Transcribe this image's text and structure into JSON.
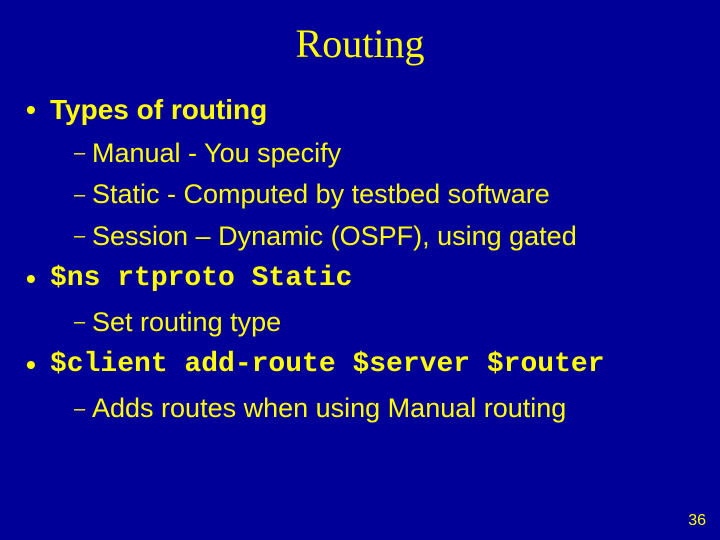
{
  "title": "Routing",
  "b1": {
    "text": "Types of routing"
  },
  "s1a": "Manual - You specify",
  "s1b": "Static - Computed by testbed software",
  "s1c": "Session – Dynamic (OSPF), using gated",
  "b2": {
    "code": "$ns rtproto Static"
  },
  "s2a": "Set routing type",
  "b3": {
    "code": "$client add-route $server $router"
  },
  "s3a": "Adds routes when using Manual routing",
  "page": "36"
}
